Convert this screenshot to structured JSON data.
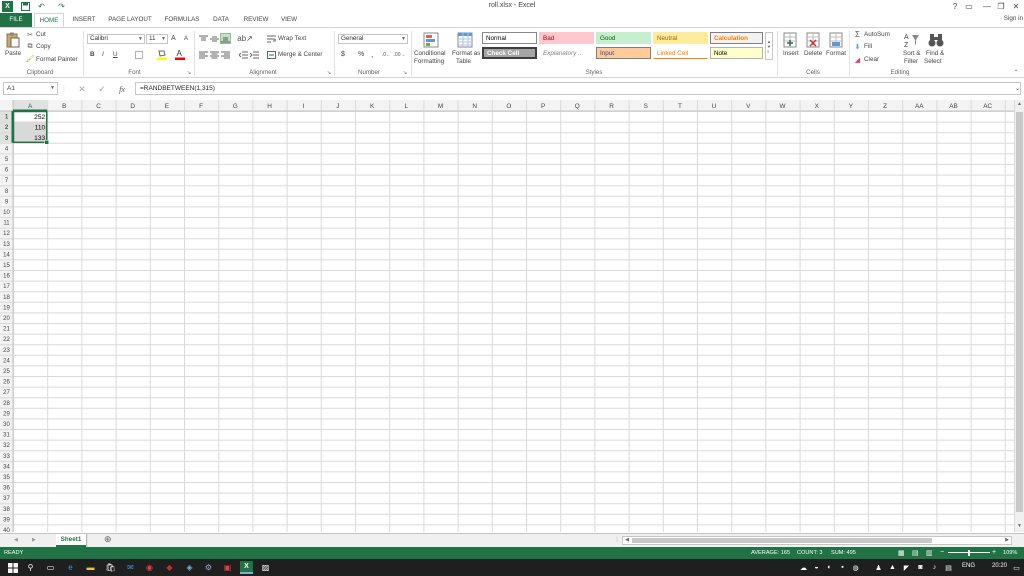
{
  "window": {
    "title": "roll.xlsx - Excel",
    "help": "?",
    "min": "—",
    "max": "❐",
    "close": "✕",
    "signin": "Sign in"
  },
  "qat": {
    "save": "💾",
    "undo": "↶",
    "redo": "↷"
  },
  "tabs": [
    "FILE",
    "HOME",
    "INSERT",
    "PAGE LAYOUT",
    "FORMULAS",
    "DATA",
    "REVIEW",
    "VIEW"
  ],
  "ribbon": {
    "clipboard": {
      "paste": "Paste",
      "cut": "Cut",
      "copy": "Copy",
      "format_painter": "Format Painter",
      "label": "Clipboard"
    },
    "font": {
      "name": "Calibri",
      "size": "11",
      "bold": "B",
      "italic": "I",
      "underline": "U",
      "grow": "A",
      "shrink": "A",
      "label": "Font"
    },
    "alignment": {
      "wrap_text": "Wrap Text",
      "merge_center": "Merge & Center",
      "label": "Alignment"
    },
    "number": {
      "format": "General",
      "currency": "$",
      "percent": "%",
      "comma": ",",
      "label": "Number"
    },
    "styles": {
      "conditional": "Conditional",
      "conditional2": "Formatting",
      "format_as": "Format as",
      "format_as2": "Table",
      "label": "Styles",
      "cells": [
        {
          "name": "Normal"
        },
        {
          "name": "Bad"
        },
        {
          "name": "Good"
        },
        {
          "name": "Neutral"
        },
        {
          "name": "Calculation"
        },
        {
          "name": "Check Cell"
        },
        {
          "name": "Explanatory ..."
        },
        {
          "name": "Input"
        },
        {
          "name": "Linked Cell"
        },
        {
          "name": "Note"
        }
      ]
    },
    "cells": {
      "insert": "Insert",
      "delete": "Delete",
      "format": "Format",
      "label": "Cells"
    },
    "editing": {
      "autosum": "AutoSum",
      "fill": "Fill",
      "clear": "Clear",
      "sort": "Sort &",
      "sort2": "Filter",
      "find": "Find &",
      "find2": "Select",
      "label": "Editing"
    }
  },
  "formula_bar": {
    "name_box": "A1",
    "fx": "fx",
    "cancel": "✕",
    "enter": "✓",
    "formula": "=RANDBETWEEN(1,315)"
  },
  "grid": {
    "columns": [
      "A",
      "B",
      "C",
      "D",
      "E",
      "F",
      "G",
      "H",
      "I",
      "J",
      "K",
      "L",
      "M",
      "N",
      "O",
      "P",
      "Q",
      "R",
      "S",
      "T",
      "U",
      "V",
      "W",
      "X",
      "Y",
      "Z",
      "AA",
      "AB",
      "AC"
    ],
    "row_count": 41,
    "cells": [
      {
        "row": 1,
        "col": "A",
        "value": "252"
      },
      {
        "row": 2,
        "col": "A",
        "value": "110"
      },
      {
        "row": 3,
        "col": "A",
        "value": "133"
      }
    ],
    "selected_rows": [
      1,
      2,
      3
    ],
    "selected_col": "A",
    "accent": "#217346"
  },
  "sheets": {
    "active": "Sheet1",
    "add": "⊕",
    "prev": "◀",
    "next": "▶"
  },
  "status": {
    "ready": "READY",
    "average": "AVERAGE: 165",
    "count": "COUNT: 3",
    "sum": "SUM: 495",
    "zoom": "109%"
  },
  "taskbar": {
    "lang": "ENG",
    "time": "20:20"
  }
}
